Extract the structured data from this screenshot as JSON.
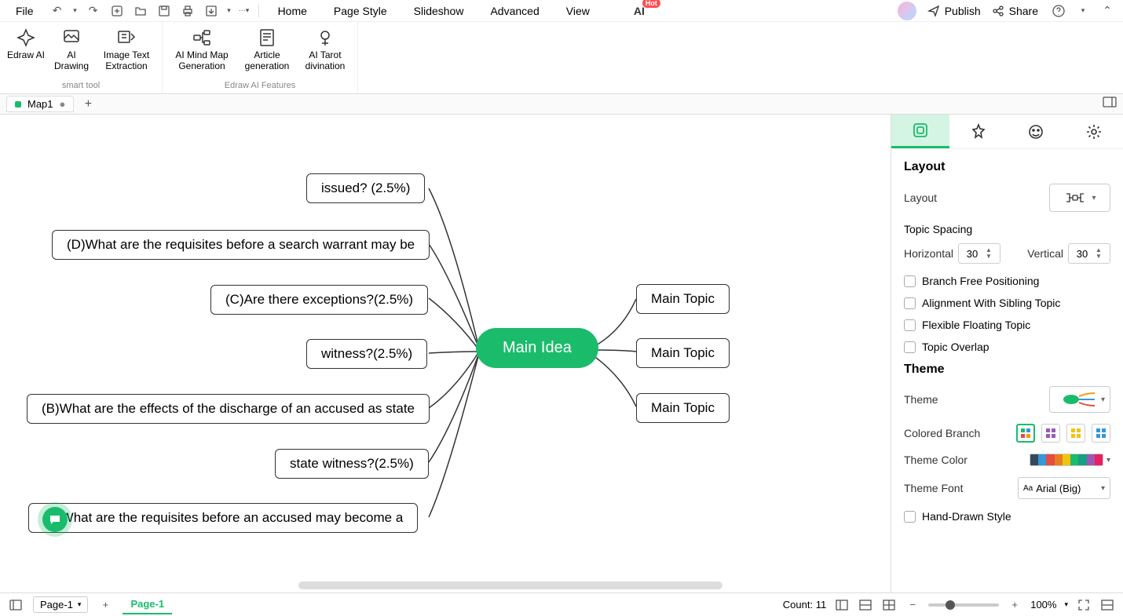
{
  "menubar": {
    "file": "File",
    "items": [
      "Home",
      "Page Style",
      "Slideshow",
      "Advanced",
      "View"
    ],
    "ai_label": "AI",
    "hot": "Hot",
    "publish": "Publish",
    "share": "Share"
  },
  "ribbon": {
    "group1_label": "smart tool",
    "group2_label": "Edraw AI Features",
    "tools1": [
      {
        "label": "Edraw AI"
      },
      {
        "label": "AI Drawing"
      },
      {
        "label": "Image Text Extraction"
      }
    ],
    "tools2": [
      {
        "label": "AI Mind Map Generation"
      },
      {
        "label": "Article generation"
      },
      {
        "label": "AI Tarot divination"
      }
    ]
  },
  "tabs": {
    "map1": "Map1"
  },
  "mindmap": {
    "root": "Main Idea",
    "right": [
      "Main Topic",
      "Main Topic",
      "Main Topic"
    ],
    "left": [
      "issued?  (2.5%)",
      "(D)What are the requisites before a search warrant may be",
      "(C)Are there exceptions?(2.5%)",
      "witness?(2.5%)",
      "(B)What are the effects of the discharge of an accused as state",
      "state witness?(2.5%)",
      "(A)What are the requisites before an accused may become a"
    ]
  },
  "rpanel": {
    "layout_h": "Layout",
    "layout_l": "Layout",
    "spacing_l": "Topic Spacing",
    "horiz": "Horizontal",
    "horiz_v": "30",
    "vert": "Vertical",
    "vert_v": "30",
    "cb_branch": "Branch Free Positioning",
    "cb_align": "Alignment With Sibling Topic",
    "cb_flex": "Flexible Floating Topic",
    "cb_overlap": "Topic Overlap",
    "theme_h": "Theme",
    "theme_l": "Theme",
    "colored_l": "Colored Branch",
    "color_l": "Theme Color",
    "font_l": "Theme Font",
    "font_v": "Arial (Big)",
    "cb_hand": "Hand-Drawn Style"
  },
  "status": {
    "page_sel": "Page-1",
    "page_tab": "Page-1",
    "count": "Count: 11",
    "zoom": "100%"
  }
}
